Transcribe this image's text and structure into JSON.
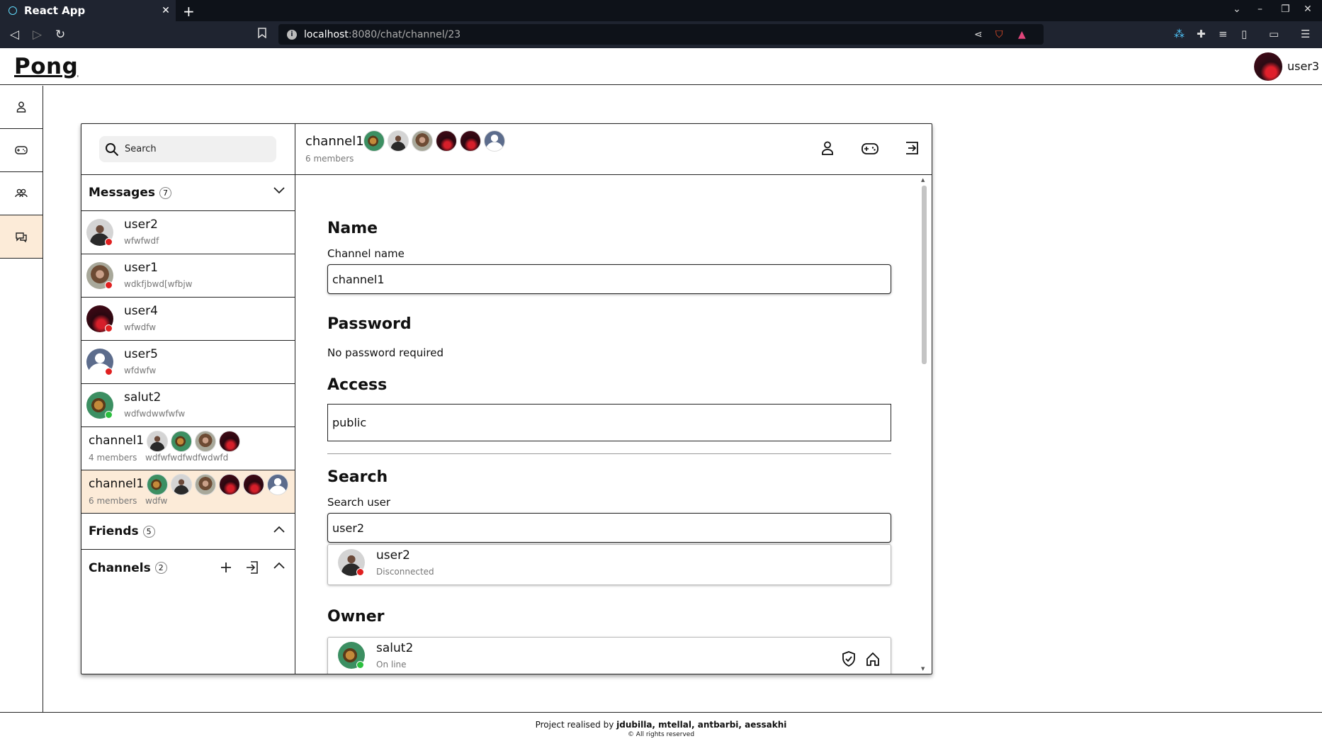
{
  "browser": {
    "tab_title": "React App",
    "url_host": "localhost",
    "url_path": ":8080/chat/channel/23"
  },
  "header": {
    "logo": "Pong",
    "user_name": "user3"
  },
  "sidebar": {
    "search_placeholder": "Search",
    "messages": {
      "label": "Messages",
      "count": "7"
    },
    "conversations": [
      {
        "name": "user2",
        "last": "wfwfwdf",
        "avatar": "man",
        "status": "red"
      },
      {
        "name": "user1",
        "last": "wdkfjbwd[wfbjw",
        "avatar": "woman",
        "status": "red"
      },
      {
        "name": "user4",
        "last": "wfwdfw",
        "avatar": "dark",
        "status": "red"
      },
      {
        "name": "user5",
        "last": "wfdwfw",
        "avatar": "default",
        "status": "red"
      },
      {
        "name": "salut2",
        "last": "wdfwdwwfwfw",
        "avatar": "green",
        "status": "green"
      }
    ],
    "channels_list": [
      {
        "name": "channel1",
        "members": "4 members",
        "last": "wdfwfwdfwdfwdwfd",
        "avatars": [
          "man",
          "green",
          "woman",
          "dark"
        ]
      },
      {
        "name": "channel1",
        "members": "6 members",
        "last": "wdfw",
        "avatars": [
          "green",
          "man",
          "woman",
          "dark",
          "dark",
          "default"
        ]
      }
    ],
    "friends": {
      "label": "Friends",
      "count": "5"
    },
    "channels": {
      "label": "Channels",
      "count": "2"
    }
  },
  "channel_header": {
    "name": "channel1",
    "members": "6 members",
    "avatars": [
      "green",
      "man",
      "woman",
      "dark",
      "dark",
      "default"
    ]
  },
  "settings": {
    "name_heading": "Name",
    "channel_name_label": "Channel name",
    "channel_name_value": "channel1",
    "password_heading": "Password",
    "password_text": "No password required",
    "access_heading": "Access",
    "access_value": "public",
    "search_heading": "Search",
    "search_user_label": "Search user",
    "search_user_value": "user2",
    "search_result": {
      "name": "user2",
      "status_text": "Disconnected"
    },
    "owner_heading": "Owner",
    "owner": {
      "name": "salut2",
      "status_text": "On line"
    }
  },
  "footer": {
    "prefix": "Project realised by",
    "authors": "jdubilla, mtellal, antbarbi, aessakhi",
    "copyright": "© All rights reserved"
  },
  "colors": {
    "selected_row": "#fcebd8",
    "status_offline": "#e02020",
    "status_online": "#2bbf3e",
    "browser_chrome": "#1f2430"
  }
}
